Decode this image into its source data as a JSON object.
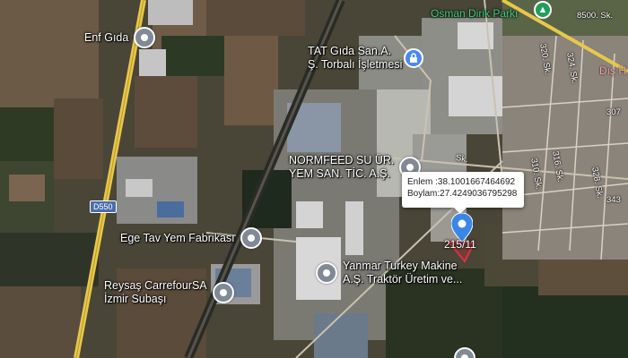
{
  "pois": [
    {
      "id": "enf",
      "label": "Enf Gıda"
    },
    {
      "id": "tat",
      "label_line1": "TAT Gıda San.A.",
      "label_line2": "Ş. Torbalı İşletmesi"
    },
    {
      "id": "normfeed",
      "label_line1": "NORMFEED SU ÜR.",
      "label_line2": "YEM SAN. TİC. A.Ş."
    },
    {
      "id": "egetav",
      "label": "Ege Tav Yem Fabrikası"
    },
    {
      "id": "reysas",
      "label_line1": "Reysaş CarrefourSA",
      "label_line2": "İzmir Subaşı"
    },
    {
      "id": "yanmar",
      "label_line1": "Yanmar Turkey Makine",
      "label_line2": "A.Ş. Traktör Üretim ve..."
    }
  ],
  "park": {
    "label": "Osman Dirik Parkı",
    "icon": "tree-icon"
  },
  "partial_label": "Dış H",
  "road_shield": "D550",
  "streets": [
    "8500. Sk.",
    "320. Sk.",
    "324. Sk.",
    "307",
    "316. Sk.",
    "310. Sk.",
    "328. Sk.",
    "343",
    "Sk."
  ],
  "infobox": {
    "lat_label": "Enlem",
    "lat_value": ":38.1001667464692",
    "lon_label": "Boylam",
    "lon_value": ":27.4249036795298"
  },
  "parcel_label": "215/11",
  "colors": {
    "marker": "#3a86e8",
    "poi_pin": "#7f8a96",
    "park": "#1e9e59",
    "road": "#e8c84a"
  }
}
